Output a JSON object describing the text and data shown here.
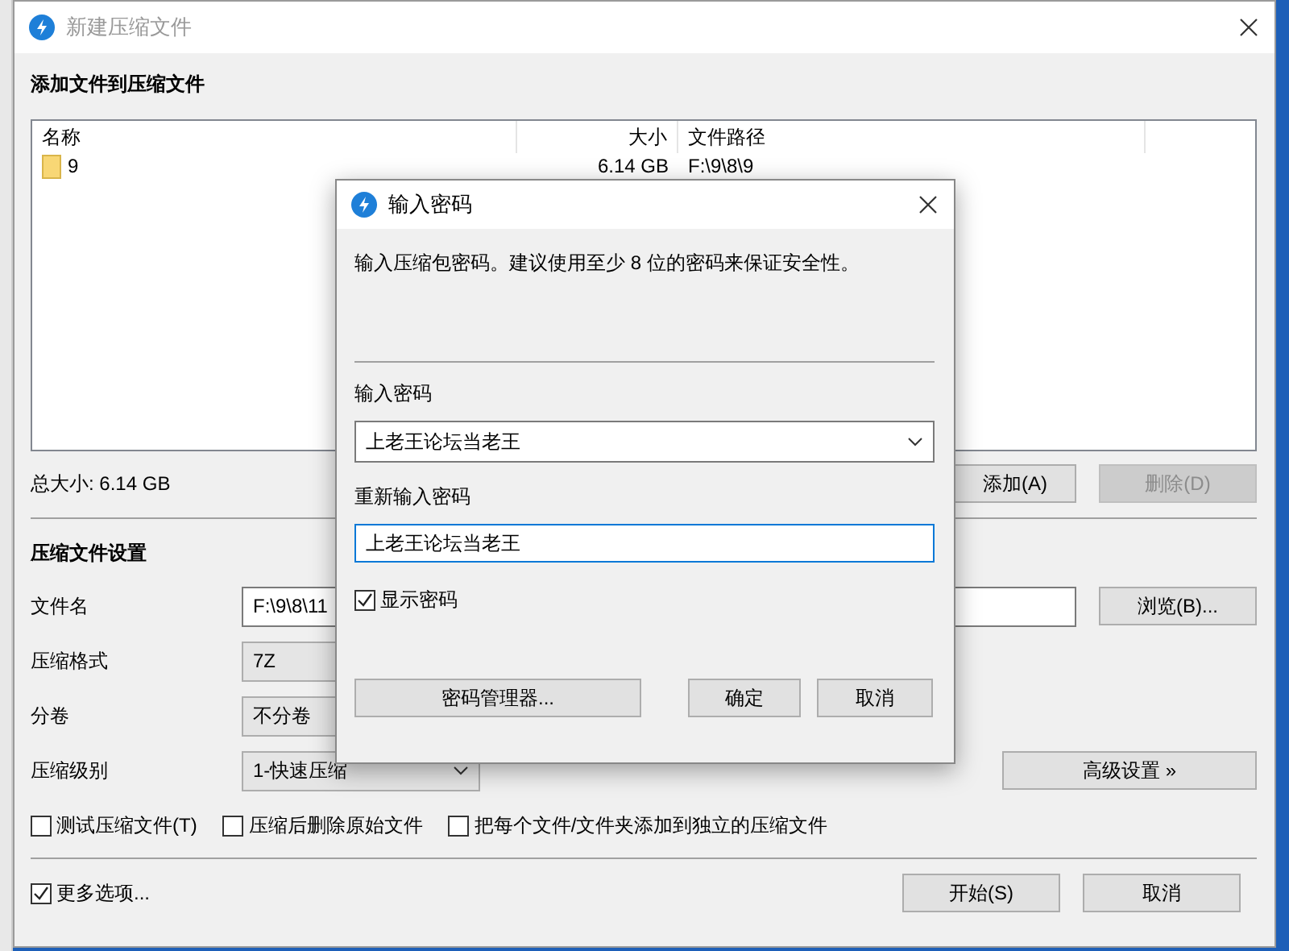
{
  "window": {
    "title": "新建压缩文件"
  },
  "files": {
    "heading": "添加文件到压缩文件",
    "columns": [
      "名称",
      "大小",
      "文件路径"
    ],
    "rows": [
      {
        "name": "9",
        "size": "6.14 GB",
        "path": "F:\\9\\8\\9"
      }
    ],
    "total": "总大小: 6.14 GB",
    "buttons": [
      {
        "label": "添加(A)",
        "disabled": false
      },
      {
        "label": "删除(D)",
        "disabled": true
      }
    ]
  },
  "settings": {
    "heading": "压缩文件设置",
    "fields": [
      {
        "kind": "text",
        "label": "文件名",
        "value": "F:\\9\\8\\11",
        "button": "浏览(B)..."
      },
      {
        "kind": "combo",
        "label": "压缩格式",
        "value": "7Z"
      },
      {
        "kind": "combo",
        "label": "分卷",
        "value": "不分卷"
      },
      {
        "kind": "select",
        "label": "压缩级别",
        "value": "1-快速压缩",
        "button": "高级设置 »"
      }
    ],
    "options": [
      {
        "label": "测试压缩文件(T)",
        "checked": false
      },
      {
        "label": "压缩后删除原始文件",
        "checked": false
      },
      {
        "label": "把每个文件/文件夹添加到独立的压缩文件",
        "checked": false
      }
    ]
  },
  "footer": {
    "more": {
      "label": "更多选项...",
      "checked": true
    },
    "buttons": [
      "开始(S)",
      "取消"
    ]
  },
  "dialog": {
    "title": "输入密码",
    "message": "输入压缩包密码。建议使用至少 8 位的密码来保证安全性。",
    "password_label": "输入密码",
    "password": "上老王论坛当老王",
    "confirm_label": "重新输入密码",
    "confirm": "上老王论坛当老王",
    "show_password": {
      "label": "显示密码",
      "checked": true
    },
    "buttons": [
      "密码管理器...",
      "确定",
      "取消"
    ]
  }
}
